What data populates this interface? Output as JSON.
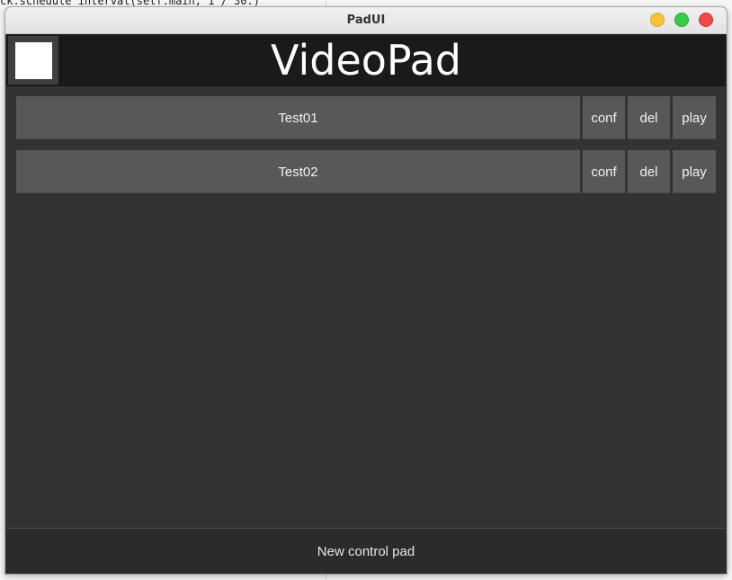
{
  "background_code": {
    "lines": [
      "ck.schedule_interval(self.main, 1 / 30.)"
    ]
  },
  "window": {
    "title": "PadUI"
  },
  "header": {
    "app_title": "VideoPad"
  },
  "pads": [
    {
      "name": "Test01",
      "conf_label": "conf",
      "del_label": "del",
      "play_label": "play"
    },
    {
      "name": "Test02",
      "conf_label": "conf",
      "del_label": "del",
      "play_label": "play"
    }
  ],
  "footer": {
    "new_pad_label": "New control pad"
  }
}
